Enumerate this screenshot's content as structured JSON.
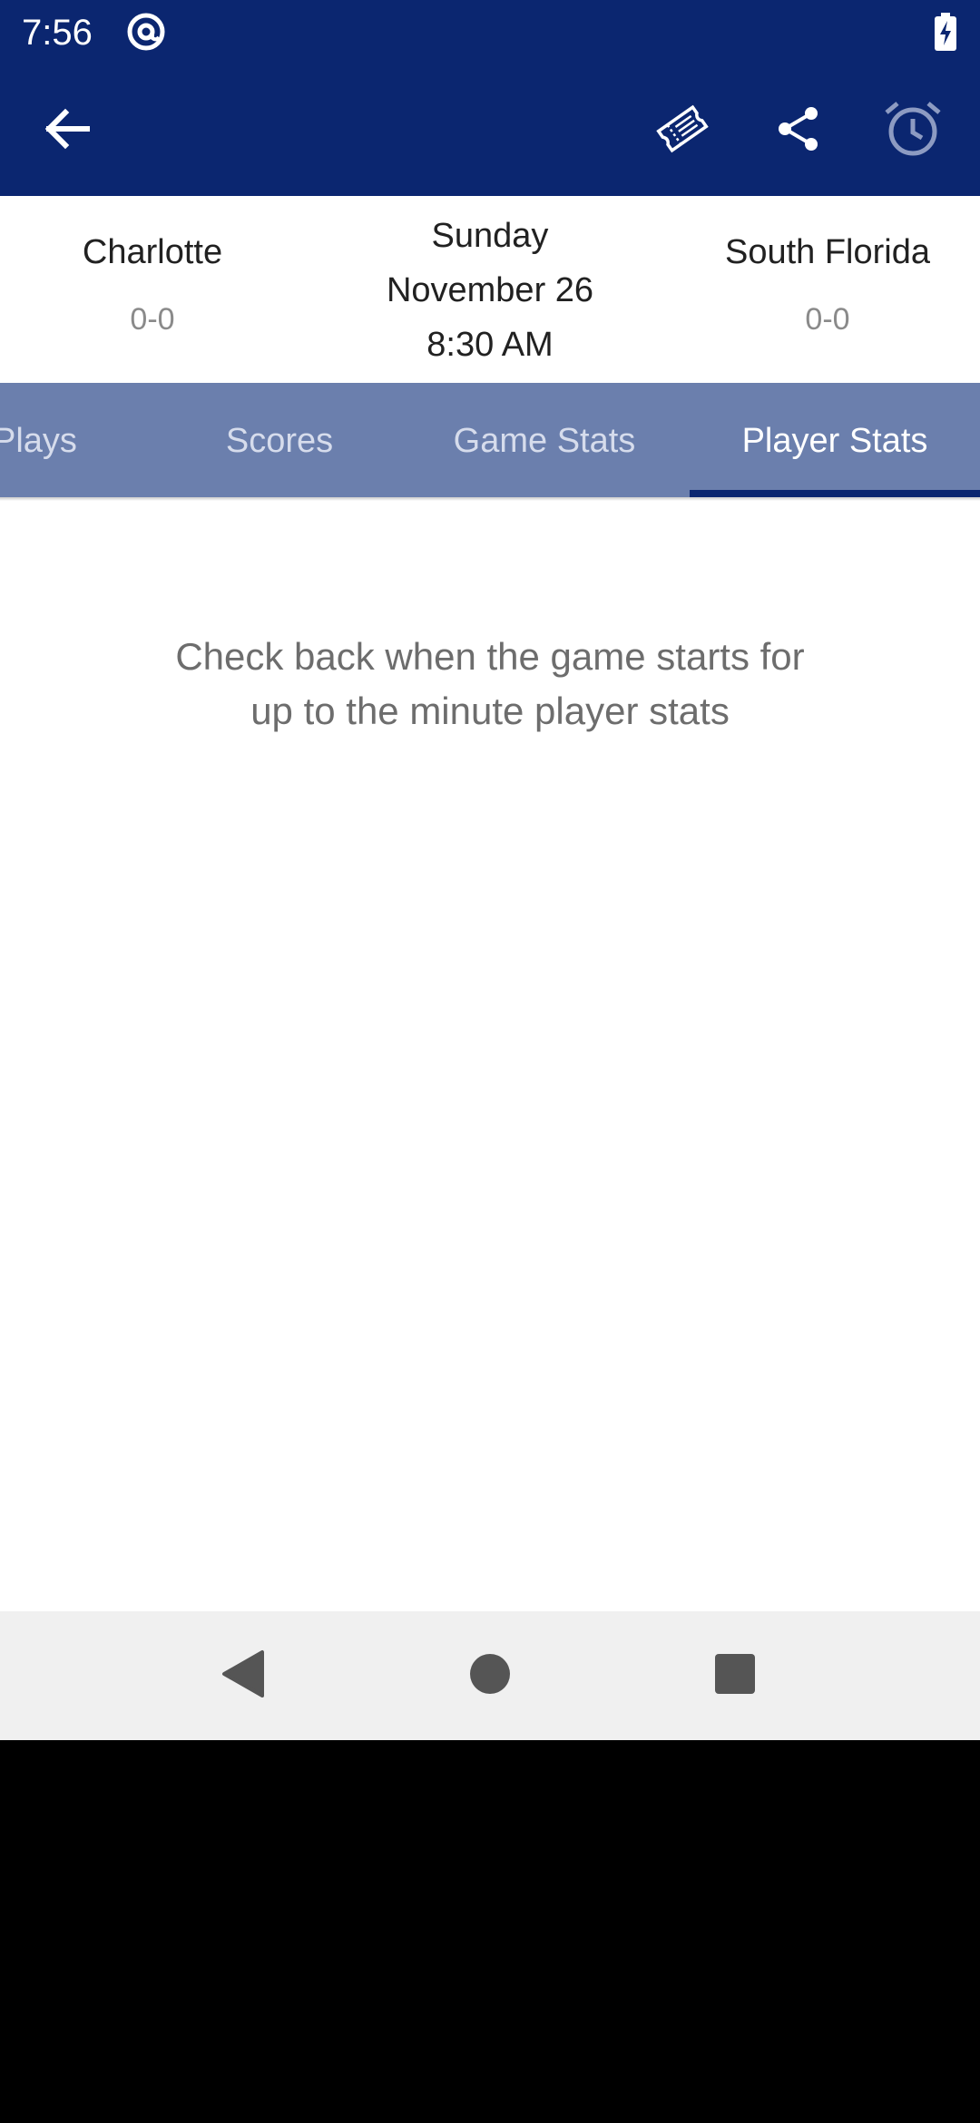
{
  "status_bar": {
    "time": "7:56",
    "app_icon": "at-sign-circle-icon",
    "battery_icon": "battery-charging-icon"
  },
  "app_bar": {
    "back_icon": "arrow-back-icon",
    "actions": [
      "ticket-icon",
      "share-icon",
      "alarm-clock-icon"
    ]
  },
  "matchup": {
    "home_team": {
      "name": "Charlotte",
      "record": "0-0"
    },
    "away_team": {
      "name": "South Florida",
      "record": "0-0"
    },
    "date": {
      "day": "Sunday",
      "date": "November 26",
      "time": "8:30 AM"
    }
  },
  "tabs": [
    {
      "label": "Plays",
      "active": false
    },
    {
      "label": "Scores",
      "active": false
    },
    {
      "label": "Game Stats",
      "active": false
    },
    {
      "label": "Player Stats",
      "active": true
    }
  ],
  "content": {
    "message_line1": "Check back when the game starts for",
    "message_line2": "up to the minute player stats"
  },
  "nav_bar": {
    "buttons": [
      "nav-back-icon",
      "nav-home-icon",
      "nav-recents-icon"
    ]
  },
  "colors": {
    "primary": "#0b2670",
    "tab_bar": "#6b7fad",
    "text": "#212121",
    "muted": "#8a8a8a"
  }
}
